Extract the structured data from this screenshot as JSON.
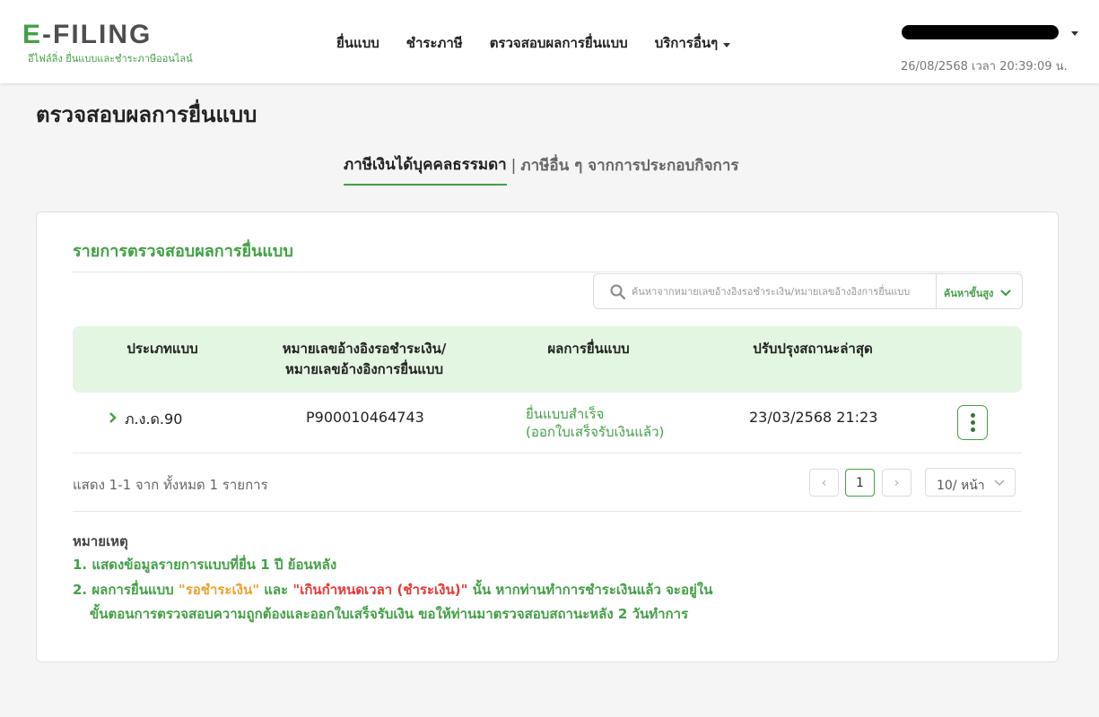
{
  "header": {
    "logo_letter": "E",
    "logo_rest": "-FILING",
    "logo_subtitle": "อีไฟล์ลิ่ง ยื่นแบบและชำระภาษีออนไลน์",
    "nav": [
      "ยื่นแบบ",
      "ชำระภาษี",
      "ตรวจสอบผลการยื่นแบบ",
      "บริการอื่นๆ"
    ],
    "datetime": "26/08/2568 เวลา 20:39:09 น."
  },
  "page": {
    "title": "ตรวจสอบผลการยื่นแบบ",
    "tab_active": "ภาษีเงินได้บุคคลธรรมดา",
    "tab_separator": "|",
    "tab_other": "ภาษีอื่น ๆ จากการประกอบกิจการ"
  },
  "card": {
    "title": "รายการตรวจสอบผลการยื่นแบบ",
    "search_placeholder": "ค้นหาจากหมายเลขอ้างอิงรอชำระเงิน/หมายเลขอ้างอิงการยื่นแบบ",
    "advanced_search": "ค้นหาขั้นสูง"
  },
  "table": {
    "headers": {
      "type": "ประเภทแบบ",
      "ref_line1": "หมายเลขอ้างอิงรอชำระเงิน/",
      "ref_line2": "หมายเลขอ้างอิงการยื่นแบบ",
      "result": "ผลการยื่นแบบ",
      "updated": "ปรับปรุงสถานะล่าสุด"
    },
    "rows": [
      {
        "type": "ภ.ง.ด.90",
        "ref": "P900010464743",
        "result_line1": "ยื่นแบบสำเร็จ",
        "result_line2": "(ออกใบเสร็จรับเงินแล้ว)",
        "updated": "23/03/2568 21:23"
      }
    ]
  },
  "pagination": {
    "summary": "แสดง 1-1 จาก ทั้งหมด 1 รายการ",
    "prev": "‹",
    "current_page": "1",
    "next": "›",
    "per_page": "10/ หน้า"
  },
  "notes": {
    "title": "หมายเหตุ",
    "item1": "1. แสดงข้อมูลรายการแบบที่ยื่น 1 ปี ย้อนหลัง",
    "item2_a": "2. ผลการยื่นแบบ ",
    "item2_b": "\"รอชำระเงิน\"",
    "item2_c": " และ ",
    "item2_d": "\"เกินกำหนดเวลา (ชำระเงิน)\"",
    "item2_e": " นั้น หากท่านทำการชำระเงินแล้ว จะอยู่ใน",
    "item2_line2": "ขั้นตอนการตรวจสอบความถูกต้องและออกใบเสร็จรับเงิน ขอให้ท่านมาตรวจสอบสถานะหลัง 2 วันทำการ"
  },
  "colors": {
    "brand_green": "#43a047",
    "header_row_bg": "#e3f6e1",
    "pending_orange": "#f0a030",
    "overdue_red": "#e53935"
  },
  "icons": [
    "search-icon",
    "chevron-down-icon",
    "chevron-right-icon",
    "kebab-menu-icon",
    "dropdown-caret-icon"
  ]
}
